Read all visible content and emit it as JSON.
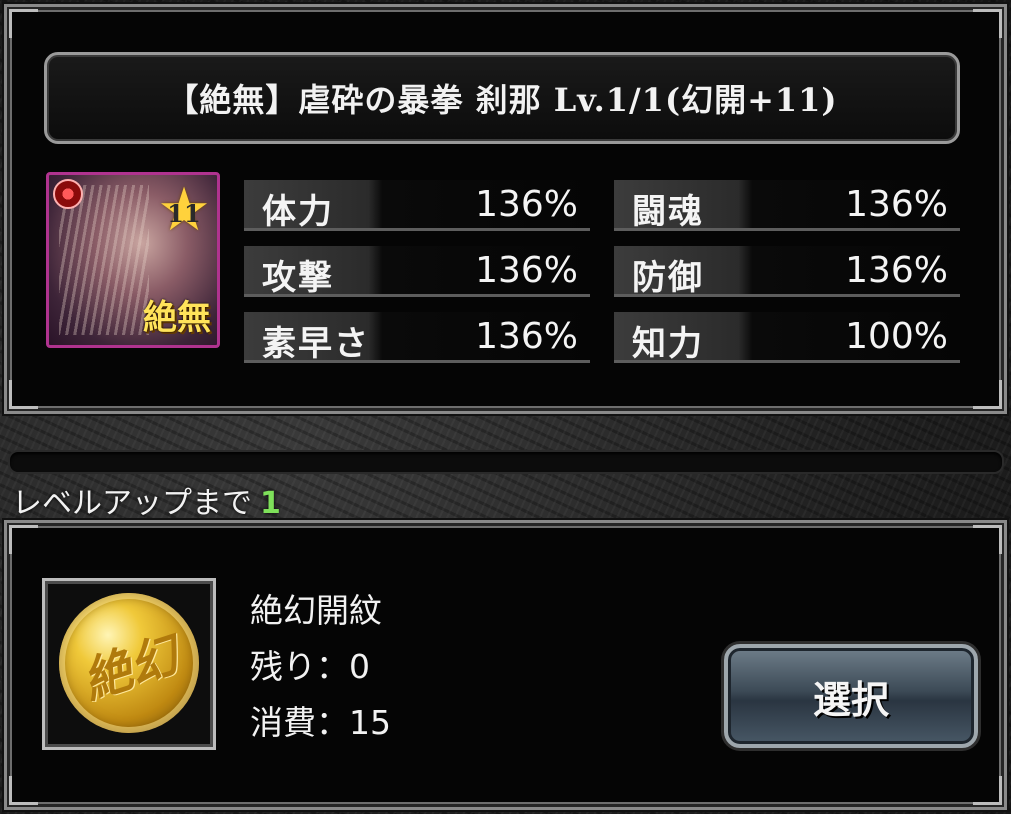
{
  "title": "【絶無】虐砕の暴拳 刹那 Lv.1/1(幻開+11)",
  "card": {
    "star_number": "11",
    "rarity_label": "絶無"
  },
  "stats": [
    {
      "label": "体力",
      "value": "136%"
    },
    {
      "label": "闘魂",
      "value": "136%"
    },
    {
      "label": "攻撃",
      "value": "136%"
    },
    {
      "label": "防御",
      "value": "136%"
    },
    {
      "label": "素早さ",
      "value": "136%"
    },
    {
      "label": "知力",
      "value": "100%"
    }
  ],
  "level_up": {
    "label": "レベルアップまで",
    "remaining": "1"
  },
  "item": {
    "coin_glyph": "絶幻",
    "name": "絶幻開紋",
    "remaining": "残り：0",
    "cost": "消費：15"
  },
  "select_button": "選択",
  "colors": {
    "accent_green": "#7ee05a",
    "card_border": "#b0338f",
    "gold": "#ffd23c"
  }
}
